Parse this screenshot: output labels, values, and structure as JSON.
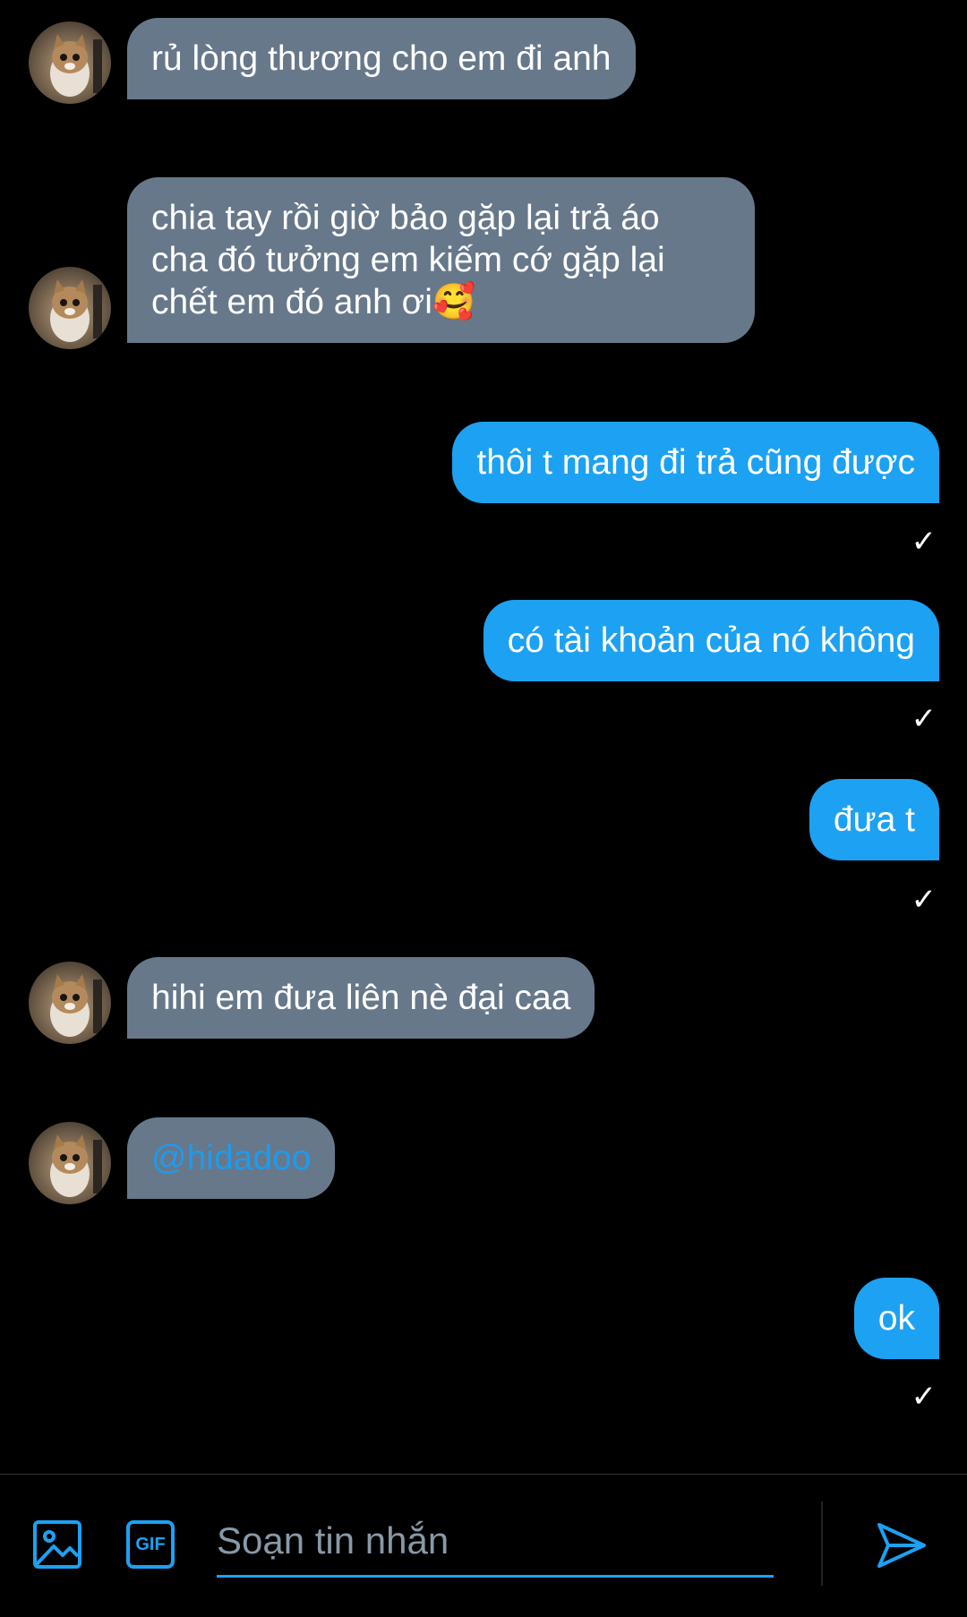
{
  "messages": [
    {
      "side": "in",
      "text": "rủ lòng thương cho em đi anh"
    },
    {
      "side": "in",
      "lines": [
        "chia tay rồi giờ bảo gặp lại trả áo",
        "cha đó tưởng em kiếm cớ gặp lại",
        "chết em đó anh ơi🥰"
      ]
    },
    {
      "side": "out",
      "text": "thôi t mang đi trả cũng được",
      "status": "✓"
    },
    {
      "side": "out",
      "text": "có tài khoản của nó không",
      "status": "✓"
    },
    {
      "side": "out",
      "text": "đưa t",
      "status": "✓"
    },
    {
      "side": "in",
      "text": "hihi em đưa liên nè đại caa"
    },
    {
      "side": "in",
      "text": "@hidadoo"
    },
    {
      "side": "out",
      "text": "ok",
      "status": "✓"
    }
  ],
  "composer": {
    "placeholder": "Soạn tin nhắn",
    "image_icon": "image-icon",
    "gif_label": "GIF",
    "send_icon": "send-icon"
  },
  "colors": {
    "incoming_bubble": "#67788a",
    "outgoing_bubble": "#1da1f2",
    "mention": "#1d9bf0",
    "background": "#000000"
  }
}
